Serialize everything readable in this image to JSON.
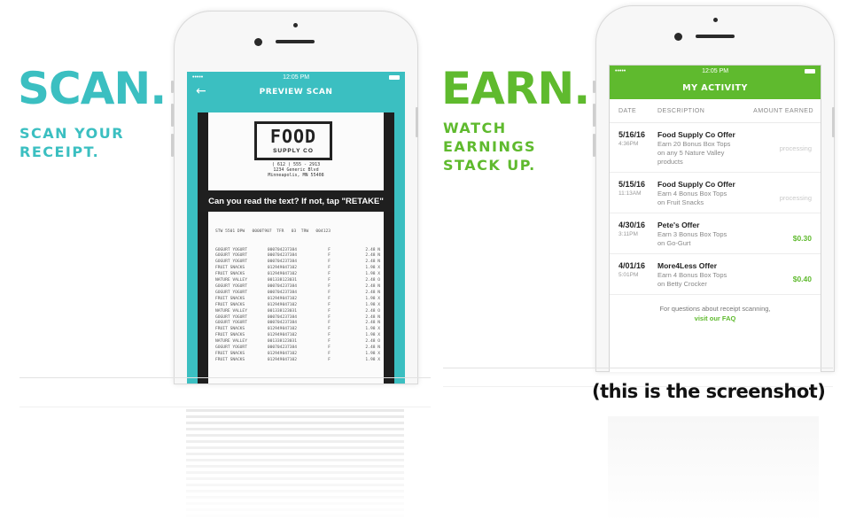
{
  "left_panel": {
    "headline": "SCAN.",
    "sub_lines": [
      "SCAN YOUR",
      "RECEIPT."
    ],
    "color": "#3bbfc1"
  },
  "right_panel": {
    "headline": "EARN.",
    "sub_lines": [
      "WATCH",
      "EARNINGS",
      "STACK UP."
    ],
    "color": "#5fba2e"
  },
  "scan_phone": {
    "status_time": "12:05 PM",
    "status_carrier": "•••••",
    "title": "PREVIEW SCAN",
    "receipt_brand": "FOOD",
    "receipt_brand_sub": "SUPPLY CO",
    "receipt_address": [
      "( 612 )  555 - 2913",
      "1234 Generic Blvd",
      "Minneapolis, MN 55408"
    ],
    "banner": "Can you read the text? If not, tap \"RETAKE\"",
    "receipt_header": "STW 5501 DPW   0000T907  TFR   03  TRW   004123",
    "receipt_items": [
      {
        "name": "GOGURT YOGURT",
        "code": "000704237384",
        "flag": "F",
        "price": "2.48 N"
      },
      {
        "name": "GOGURT YOGURT",
        "code": "000704237384",
        "flag": "F",
        "price": "2.48 N"
      },
      {
        "name": "GOGURT YOGURT",
        "code": "000704237384",
        "flag": "F",
        "price": "2.48 N"
      },
      {
        "name": "FRUIT SNACKS",
        "code": "012949047102",
        "flag": "F",
        "price": "1.98 X"
      },
      {
        "name": "FRUIT SNACKS",
        "code": "012949047102",
        "flag": "F",
        "price": "1.98 X"
      },
      {
        "name": "NATURE VALLEY",
        "code": "001338123031",
        "flag": "F",
        "price": "2.48 O"
      },
      {
        "name": "GOGURT YOGURT",
        "code": "000704237384",
        "flag": "F",
        "price": "2.48 N"
      },
      {
        "name": "GOGURT YOGURT",
        "code": "000704237384",
        "flag": "F",
        "price": "2.48 N"
      },
      {
        "name": "FRUIT SNACKS",
        "code": "012949047102",
        "flag": "F",
        "price": "1.98 X"
      },
      {
        "name": "FRUIT SNACKS",
        "code": "012949047102",
        "flag": "F",
        "price": "1.98 X"
      },
      {
        "name": "NATURE VALLEY",
        "code": "001338123031",
        "flag": "F",
        "price": "2.48 O"
      },
      {
        "name": "GOGURT YOGURT",
        "code": "000704237384",
        "flag": "F",
        "price": "2.48 N"
      },
      {
        "name": "GOGURT YOGURT",
        "code": "000704237384",
        "flag": "F",
        "price": "2.48 N"
      },
      {
        "name": "FRUIT SNACKS",
        "code": "012949047102",
        "flag": "F",
        "price": "1.98 X"
      },
      {
        "name": "FRUIT SNACKS",
        "code": "012949047102",
        "flag": "F",
        "price": "1.98 X"
      },
      {
        "name": "NATURE VALLEY",
        "code": "001338123031",
        "flag": "F",
        "price": "2.48 O"
      },
      {
        "name": "GOGURT YOGURT",
        "code": "000704237384",
        "flag": "F",
        "price": "2.48 N"
      },
      {
        "name": "FRUIT SNACKS",
        "code": "012949047102",
        "flag": "F",
        "price": "1.98 X"
      },
      {
        "name": "FRUIT SNACKS",
        "code": "012949047102",
        "flag": "F",
        "price": "1.98 X"
      }
    ]
  },
  "activity_phone": {
    "status_time": "12:05 PM",
    "status_carrier": "•••••",
    "title": "MY ACTIVITY",
    "columns": {
      "date": "DATE",
      "description": "DESCRIPTION",
      "amount": "AMOUNT EARNED"
    },
    "rows": [
      {
        "date": "5/16/16",
        "time": "4:36PM",
        "title": "Food Supply Co Offer",
        "desc": [
          "Earn 20 Bonus Box Tops",
          "on any 5 Nature Valley",
          "products"
        ],
        "amount": "processing",
        "status": "processing"
      },
      {
        "date": "5/15/16",
        "time": "11:13AM",
        "title": "Food Supply Co Offer",
        "desc": [
          "Earn 4 Bonus Box Tops",
          "on Fruit Snacks"
        ],
        "amount": "processing",
        "status": "processing"
      },
      {
        "date": "4/30/16",
        "time": "3:11PM",
        "title": "Pete's Offer",
        "desc": [
          "Earn 3 Bonus Box Tops",
          "on Go-Gurt"
        ],
        "amount": "$0.30",
        "status": "paid"
      },
      {
        "date": "4/01/16",
        "time": "5:01PM",
        "title": "More4Less Offer",
        "desc": [
          "Earn 4 Bonus Box Tops",
          "on Betty Crocker"
        ],
        "amount": "$0.40",
        "status": "paid"
      }
    ],
    "footer_text": "For questions about receipt scanning,",
    "footer_link": "visit our FAQ"
  },
  "caption": "(this is the screenshot)"
}
